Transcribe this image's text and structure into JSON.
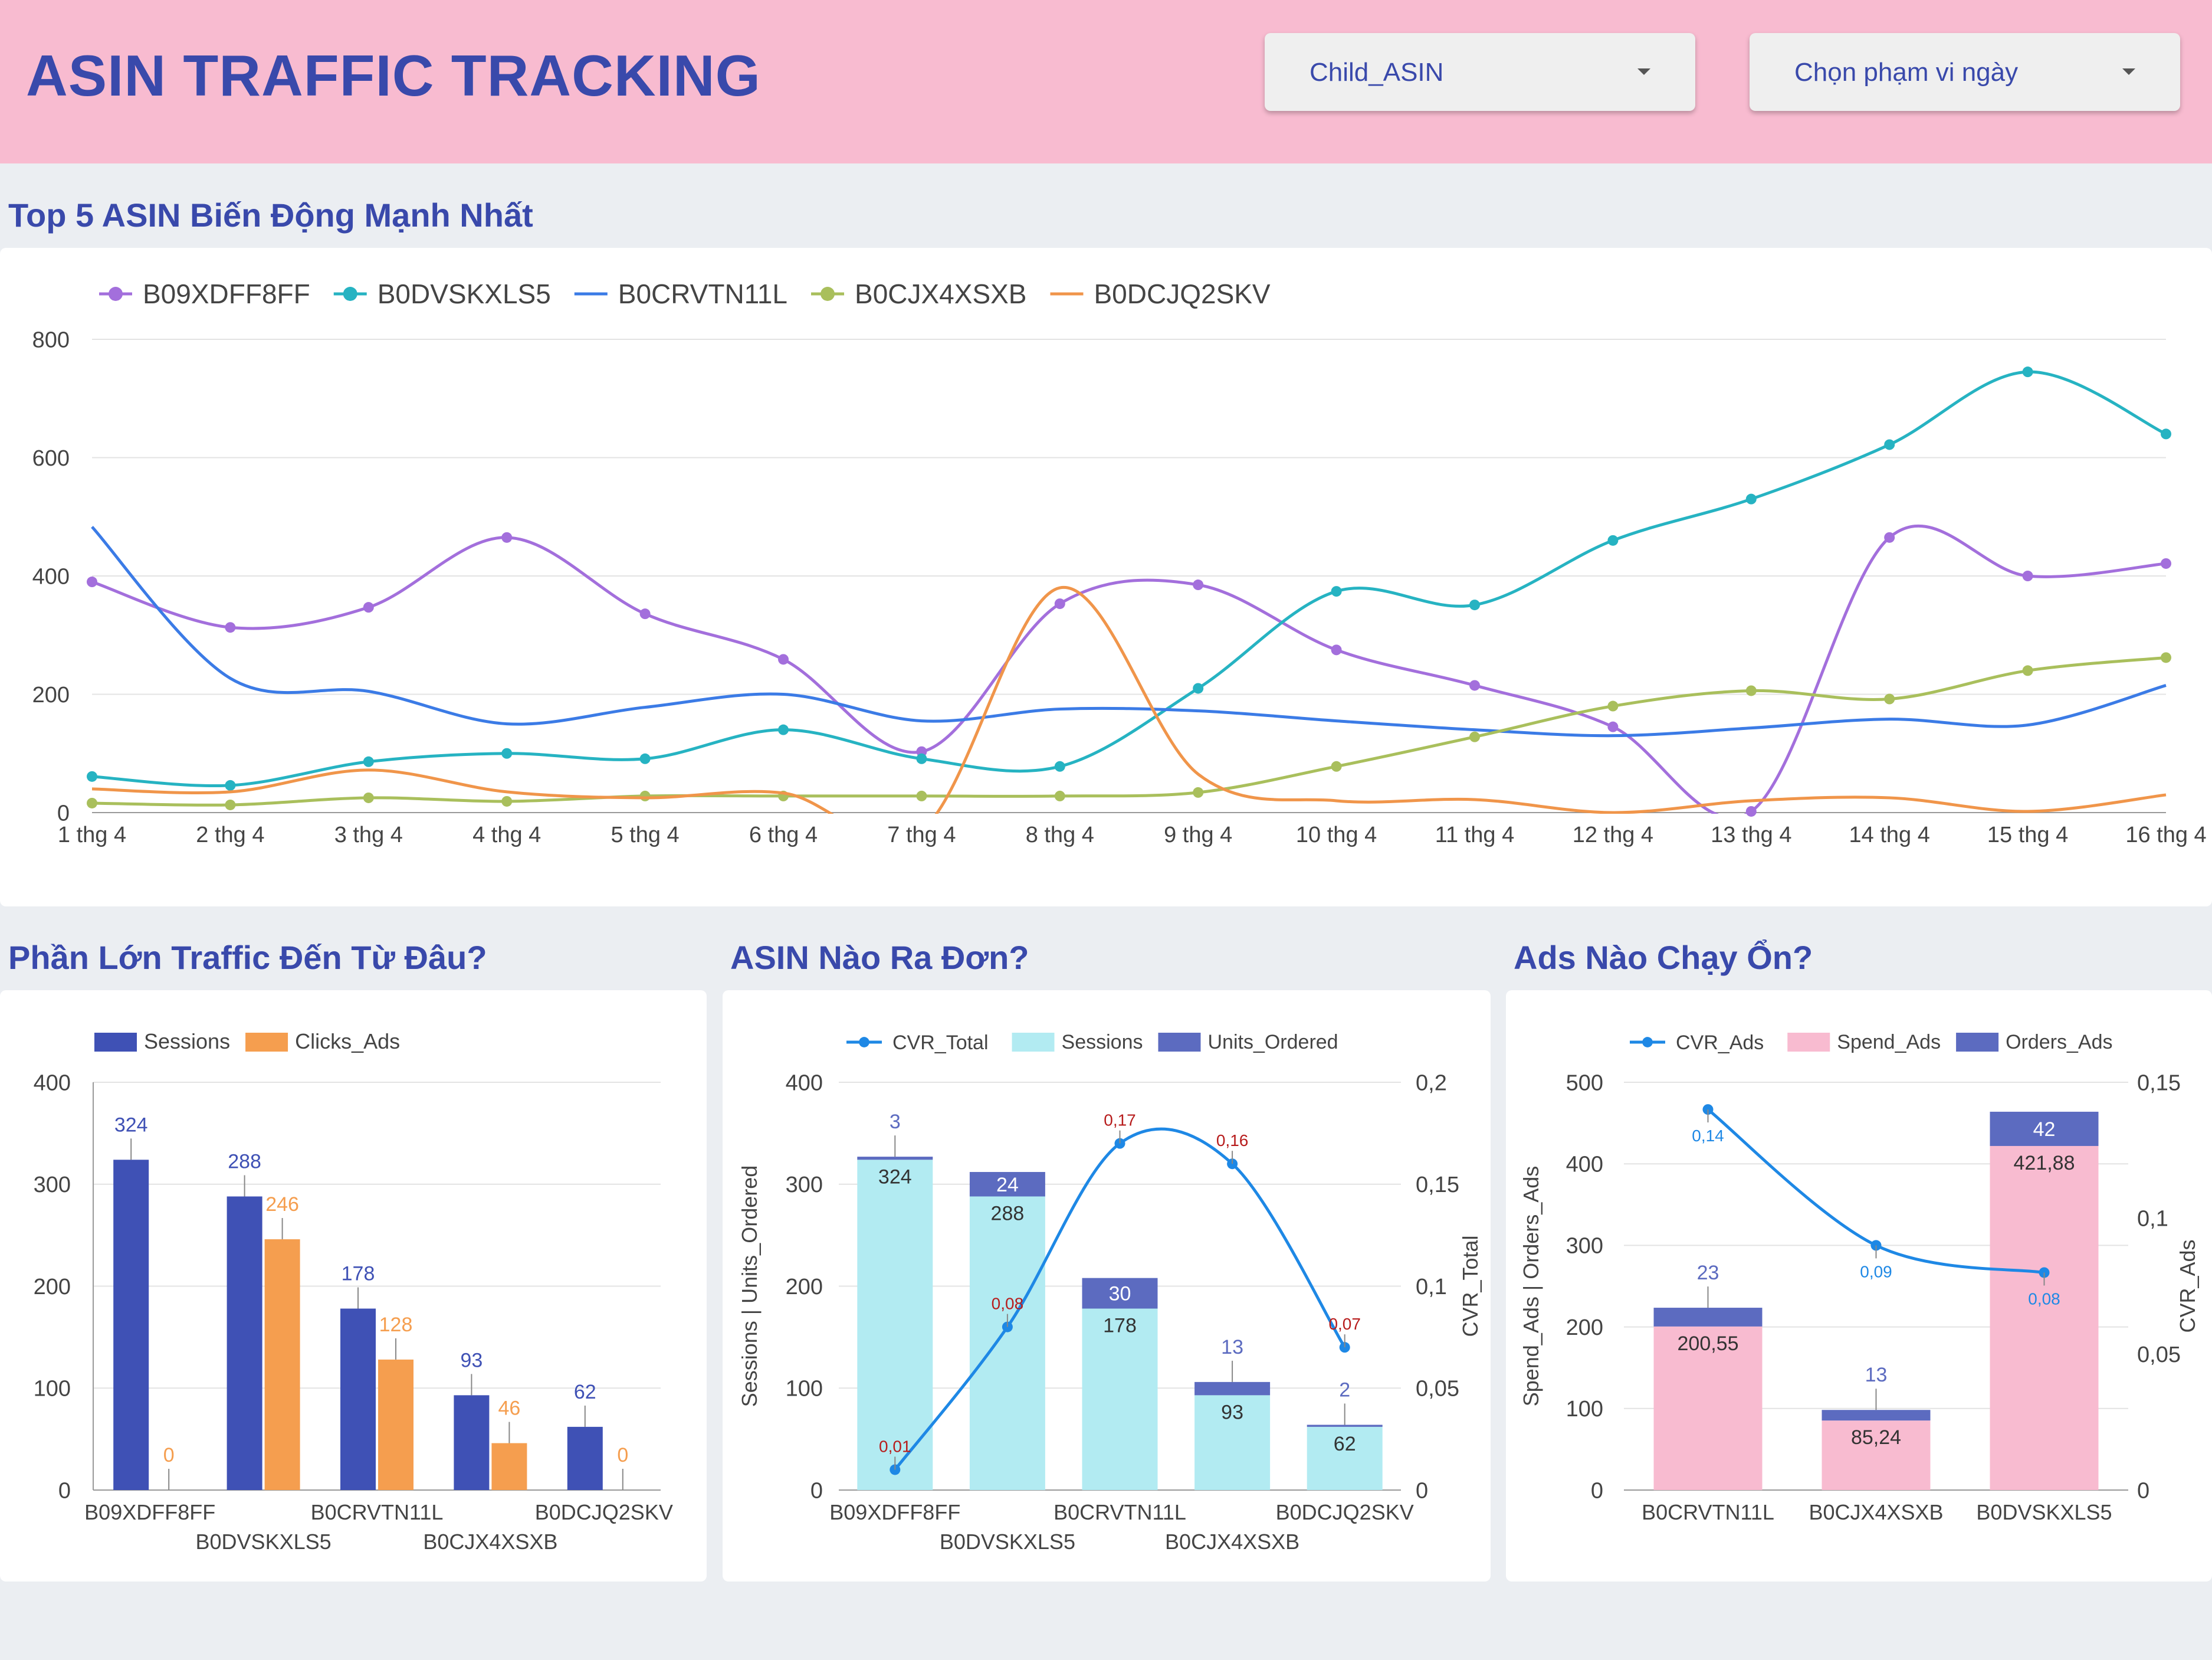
{
  "header": {
    "title": "ASIN TRAFFIC TRACKING",
    "dropdown_asin": "Child_ASIN",
    "dropdown_date": "Chọn phạm vi ngày"
  },
  "colors": {
    "header_bg": "#f8bbd0",
    "title": "#3949ab",
    "page_bg": "#ebeef2"
  },
  "icons": {
    "dropdown": "caret-down-icon"
  },
  "chart_data": [
    {
      "type": "line",
      "title": "Top 5 ASIN Biến Động Mạnh Nhất",
      "legend_position": "top-left",
      "grid": true,
      "ylim": [
        0,
        800
      ],
      "yticks": [
        "0",
        "200",
        "400",
        "600",
        "800"
      ],
      "x": [
        "1 thg 4",
        "2 thg 4",
        "3 thg 4",
        "4 thg 4",
        "5 thg 4",
        "6 thg 4",
        "7 thg 4",
        "8 thg 4",
        "9 thg 4",
        "10 thg 4",
        "11 thg 4",
        "12 thg 4",
        "13 thg 4",
        "14 thg 4",
        "15 thg 4",
        "16 thg 4"
      ],
      "series": [
        {
          "name": "B09XDFF8FF",
          "color": "#a36fdc",
          "markers": true,
          "values": [
            390,
            313,
            347,
            465,
            336,
            259,
            103,
            353,
            385,
            275,
            215,
            145,
            2,
            465,
            400,
            421
          ]
        },
        {
          "name": "B0DVSKXLS5",
          "color": "#26b3c2",
          "markers": true,
          "values": [
            61,
            46,
            86,
            100,
            91,
            140,
            91,
            78,
            210,
            374,
            351,
            460,
            530,
            622,
            745,
            640
          ]
        },
        {
          "name": "B0CRVTN11L",
          "color": "#3b7be6",
          "markers": false,
          "values": [
            483,
            227,
            205,
            150,
            178,
            200,
            155,
            175,
            172,
            155,
            140,
            130,
            143,
            158,
            148,
            215
          ]
        },
        {
          "name": "B0CJX4XSXB",
          "color": "#a9bf5c",
          "markers": true,
          "values": [
            16,
            13,
            25,
            19,
            28,
            28,
            28,
            28,
            34,
            78,
            128,
            180,
            206,
            192,
            240,
            262
          ]
        },
        {
          "name": "B0DCJQ2SKV",
          "color": "#f0954a",
          "markers": false,
          "values": [
            40,
            35,
            72,
            35,
            25,
            33,
            -30,
            380,
            65,
            20,
            22,
            0,
            20,
            25,
            2,
            30
          ]
        }
      ]
    },
    {
      "type": "bar",
      "title": "Phần Lớn Traffic Đến Từ Đâu?",
      "legend_position": "top-left",
      "grid": true,
      "ylim": [
        0,
        400
      ],
      "yticks": [
        "0",
        "100",
        "200",
        "300",
        "400"
      ],
      "categories": [
        "B09XDFF8FF",
        "B0DVSKXLS5",
        "B0CRVTN11L",
        "B0CJX4XSXB",
        "B0DCJQ2SKV"
      ],
      "series": [
        {
          "name": "Sessions",
          "color": "#3f51b5",
          "values": [
            324,
            288,
            178,
            93,
            62
          ]
        },
        {
          "name": "Clicks_Ads",
          "color": "#f59e4f",
          "values": [
            0,
            246,
            128,
            46,
            0
          ]
        }
      ]
    },
    {
      "type": "bar",
      "title": "ASIN Nào Ra Đơn?",
      "legend_position": "top-left",
      "grid": true,
      "ylim": [
        0,
        400
      ],
      "yticks": [
        "0",
        "100",
        "200",
        "300",
        "400"
      ],
      "ylabel": "Sessions | Units_Ordered",
      "y2lim": [
        0,
        0.2
      ],
      "y2ticks": [
        "0",
        "0,05",
        "0,1",
        "0,15",
        "0,2"
      ],
      "y2label": "CVR_Total",
      "categories": [
        "B09XDFF8FF",
        "B0DVSKXLS5",
        "B0CRVTN11L",
        "B0CJX4XSXB",
        "B0DCJQ2SKV"
      ],
      "series": [
        {
          "name": "CVR_Total",
          "type": "line",
          "axis": "right",
          "color": "#1e88e5",
          "values": [
            0.01,
            0.08,
            0.17,
            0.16,
            0.07
          ],
          "labels": [
            "0,01",
            "0,08",
            "0,17",
            "0,16",
            "0,07"
          ]
        },
        {
          "name": "Sessions",
          "type": "stacked-bar",
          "color": "#b2ebf2",
          "values": [
            324,
            288,
            178,
            93,
            62
          ]
        },
        {
          "name": "Units_Ordered",
          "type": "stacked-bar",
          "color": "#5c6bc0",
          "values": [
            3,
            24,
            30,
            13,
            2
          ]
        }
      ]
    },
    {
      "type": "bar",
      "title": "Ads Nào Chạy Ổn?",
      "legend_position": "top-left",
      "grid": true,
      "ylim": [
        0,
        500
      ],
      "yticks": [
        "0",
        "100",
        "200",
        "300",
        "400",
        "500"
      ],
      "ylabel": "Spend_Ads | Orders_Ads",
      "y2lim": [
        0,
        0.15
      ],
      "y2ticks": [
        "0",
        "0,05",
        "0,1",
        "0,15"
      ],
      "y2label": "CVR_Ads",
      "categories": [
        "B0CRVTN11L",
        "B0CJX4XSXB",
        "B0DVSKXLS5"
      ],
      "series": [
        {
          "name": "CVR_Ads",
          "type": "line",
          "axis": "right",
          "color": "#1e88e5",
          "values": [
            0.14,
            0.09,
            0.08
          ],
          "labels": [
            "0,14",
            "0,09",
            "0,08"
          ]
        },
        {
          "name": "Spend_Ads",
          "type": "stacked-bar",
          "color": "#f8bbd0",
          "values": [
            200.55,
            85.24,
            421.88
          ],
          "labels": [
            "200,55",
            "85,24",
            "421,88"
          ]
        },
        {
          "name": "Orders_Ads",
          "type": "stacked-bar",
          "color": "#5c6bc0",
          "values": [
            23,
            13,
            42
          ]
        }
      ]
    }
  ]
}
